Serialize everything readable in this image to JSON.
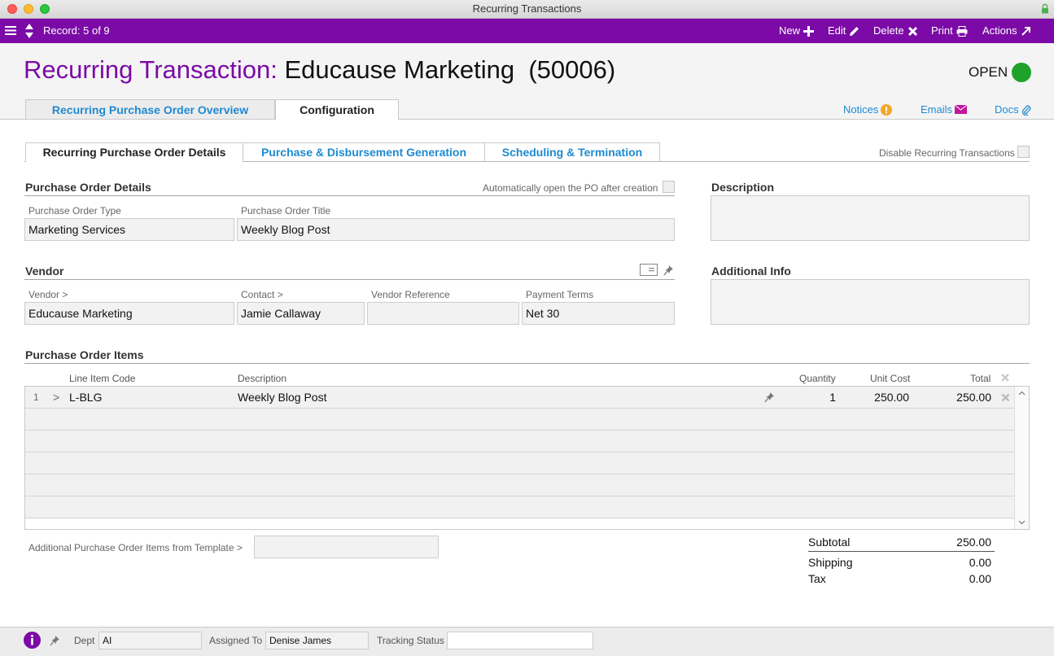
{
  "window": {
    "title": "Recurring Transactions"
  },
  "toolbar": {
    "record_label": "Record: 5 of 9",
    "new_label": "New",
    "edit_label": "Edit",
    "delete_label": "Delete",
    "print_label": "Print",
    "actions_label": "Actions"
  },
  "header": {
    "title_prefix": "Recurring Transaction:",
    "record_name": "Educause Marketing",
    "record_id": "(50006)",
    "status": "OPEN",
    "status_color": "#1fa22a"
  },
  "main_tabs": [
    {
      "label": "Recurring Purchase Order Overview",
      "active": false
    },
    {
      "label": "Configuration",
      "active": true
    }
  ],
  "top_links": {
    "notices": "Notices",
    "emails": "Emails",
    "docs": "Docs"
  },
  "sub_tabs": [
    {
      "label": "Recurring Purchase Order Details",
      "active": true
    },
    {
      "label": "Purchase & Disbursement Generation",
      "active": false
    },
    {
      "label": "Scheduling & Termination",
      "active": false
    }
  ],
  "disable_recurring_label": "Disable Recurring Transactions",
  "po_details": {
    "heading": "Purchase Order Details",
    "auto_open_label": "Automatically open the PO after creation",
    "type_label": "Purchase Order Type",
    "type_value": "Marketing Services",
    "title_label": "Purchase Order Title",
    "title_value": "Weekly Blog Post"
  },
  "vendor": {
    "heading": "Vendor",
    "vendor_label": "Vendor >",
    "vendor_value": "Educause Marketing",
    "contact_label": "Contact >",
    "contact_value": "Jamie Callaway",
    "reference_label": "Vendor Reference",
    "reference_value": "",
    "terms_label": "Payment Terms",
    "terms_value": "Net 30"
  },
  "description": {
    "heading": "Description"
  },
  "additional_info": {
    "heading": "Additional Info"
  },
  "items": {
    "heading": "Purchase Order Items",
    "columns": {
      "code": "Line Item Code",
      "description": "Description",
      "quantity": "Quantity",
      "unit_cost": "Unit Cost",
      "total": "Total"
    },
    "rows": [
      {
        "num": "1",
        "code": "L-BLG",
        "description": "Weekly Blog Post",
        "quantity": "1",
        "unit_cost": "250.00",
        "total": "250.00"
      }
    ],
    "template_label": "Additional Purchase Order Items from Template >",
    "template_value": ""
  },
  "totals": {
    "subtotal_label": "Subtotal",
    "subtotal_value": "250.00",
    "shipping_label": "Shipping",
    "shipping_value": "0.00",
    "tax_label": "Tax",
    "tax_value": "0.00"
  },
  "footer": {
    "dept_label": "Dept",
    "dept_value": "AI",
    "assigned_label": "Assigned To",
    "assigned_value": "Denise James",
    "tracking_label": "Tracking Status",
    "tracking_value": ""
  },
  "colors": {
    "accent": "#7b0aa6",
    "link": "#1e8ad1"
  }
}
